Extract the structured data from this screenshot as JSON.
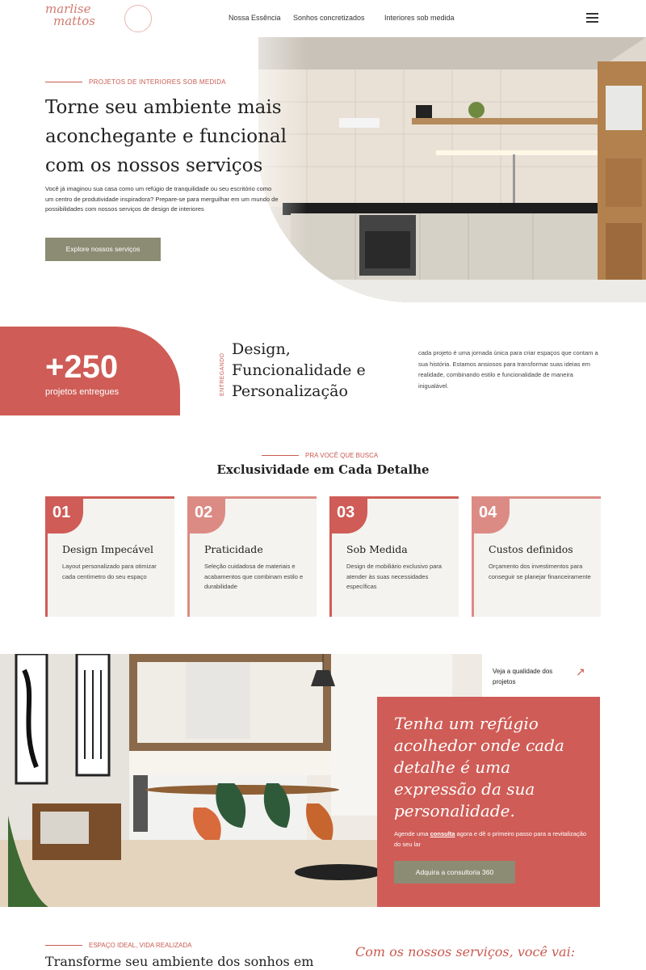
{
  "brand": {
    "logo_line1": "marlise",
    "logo_line2": "mattos"
  },
  "nav": {
    "items": [
      "Nossa Essência",
      "Sonhos concretizados",
      "Interiores sob medida"
    ]
  },
  "hero": {
    "eyebrow": "PROJETOS DE INTERIORES SOB MEDIDA",
    "title": "Torne seu ambiente mais aconchegante e funcional com os nossos serviços",
    "text": "Você já imaginou sua casa como um refúgio de tranquilidade ou seu escritório como um centro de produtividade inspiradora? Prepare-se para merguilhar em um mundo de possibilidades com nossos serviços de design de interiores",
    "button": "Explore nossos serviços"
  },
  "stats": {
    "number": "+250",
    "label": "projetos entregues",
    "vertical_label": "ENTREGANDO",
    "design_title": "Design, Funcionalidade e Personalização",
    "description": "cada projeto é uma jornada única para criar espaços que contam a sua história. Estamos ansiosos para transformar suas ideias em realidade, combinando estilo e funcionalidade de maneira inigualável."
  },
  "exclusivity": {
    "eyebrow": "PRA VOCÊ QUE BUSCA",
    "title": "Exclusividade em Cada Detalhe",
    "cards": [
      {
        "num": "01",
        "title": "Design Impecável",
        "desc": "Layout personalizado para otimizar cada centímetro do seu espaço"
      },
      {
        "num": "02",
        "title": "Praticidade",
        "desc": "Seleção cuidadosa de materiais e acabamentos que combinam estilo e durabilidade"
      },
      {
        "num": "03",
        "title": "Sob Medida",
        "desc": "Design de mobiliário exclusivo para atender às suas necessidades específicas"
      },
      {
        "num": "04",
        "title": "Custos definidos",
        "desc": "Orçamento dos investimentos para conseguir se planejar financeiramente"
      }
    ]
  },
  "promo": {
    "quality_link": "Veja a qualidade dos projetos",
    "title": "Tenha um refúgio acolhedor onde cada detalhe é uma expressão da sua personalidade.",
    "text_before": "Agende uma ",
    "text_link": "consulta",
    "text_after": " agora e dê o primeiro passo para a revitalização do seu lar",
    "button": "Adquira a consultoria 360"
  },
  "bottom": {
    "eyebrow": "ESPAÇO IDEAL, VIDA REALIZADA",
    "title": "Transforme seu ambiente dos sonhos em",
    "right_title": "Com os nossos serviços, você vai:"
  },
  "icons": {
    "menu": "hamburger-menu-icon",
    "arrow": "arrow-up-right-icon"
  },
  "colors": {
    "accent": "#cf5c56",
    "accent_light": "#dc8b84",
    "olive": "#8c8c74",
    "card_bg": "#f4f3ef"
  }
}
